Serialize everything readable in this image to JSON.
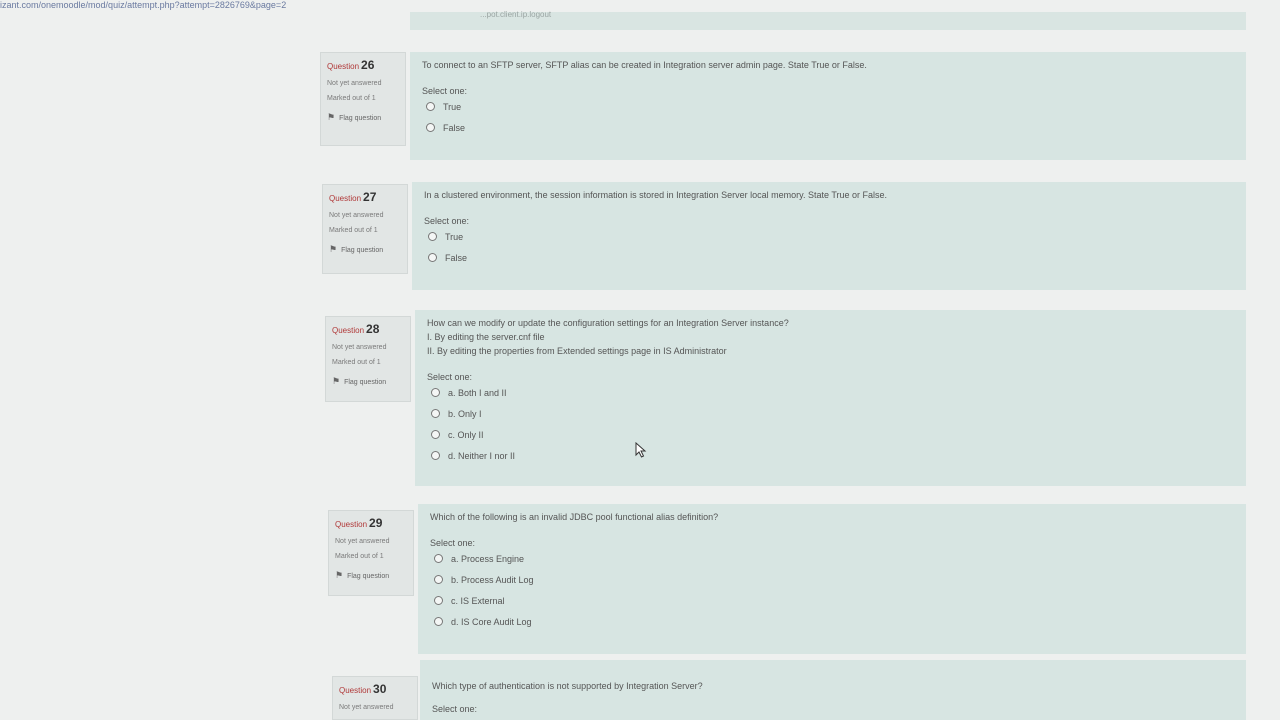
{
  "url": "izant.com/onemoodle/mod/quiz/attempt.php?attempt=2826769&page=2",
  "top_strip_text": "...pot.client.ip.logout",
  "questions": [
    {
      "label": "Question",
      "number": "26",
      "state": "Not yet answered",
      "mark": "Marked out of 1",
      "flag": "Flag question",
      "text": [
        "To connect to an SFTP server, SFTP alias can be created in Integration server admin page. State True or False."
      ],
      "select_one": "Select one:",
      "options": [
        "True",
        "False"
      ]
    },
    {
      "label": "Question",
      "number": "27",
      "state": "Not yet answered",
      "mark": "Marked out of 1",
      "flag": "Flag question",
      "text": [
        "In a clustered environment, the session information is stored in Integration Server local memory. State True or False."
      ],
      "select_one": "Select one:",
      "options": [
        "True",
        "False"
      ]
    },
    {
      "label": "Question",
      "number": "28",
      "state": "Not yet answered",
      "mark": "Marked out of 1",
      "flag": "Flag question",
      "text": [
        "How can we modify or update the configuration settings for an Integration Server instance?",
        "I. By editing the server.cnf file",
        "II. By editing the properties from Extended settings page in IS Administrator"
      ],
      "select_one": "Select one:",
      "options": [
        "a. Both I and II",
        "b. Only I",
        "c. Only II",
        "d. Neither I nor II"
      ]
    },
    {
      "label": "Question",
      "number": "29",
      "state": "Not yet answered",
      "mark": "Marked out of 1",
      "flag": "Flag question",
      "text": [
        "Which of the following is an invalid JDBC pool functional alias definition?"
      ],
      "select_one": "Select one:",
      "options": [
        "a. Process Engine",
        "b. Process Audit Log",
        "c. IS External",
        "d. IS Core Audit Log"
      ]
    },
    {
      "label": "Question",
      "number": "30",
      "state": "Not yet answered",
      "mark": "",
      "flag": "",
      "text": [
        "Which type of authentication is not supported by Integration Server?"
      ],
      "select_one": "Select one:",
      "options": []
    }
  ]
}
